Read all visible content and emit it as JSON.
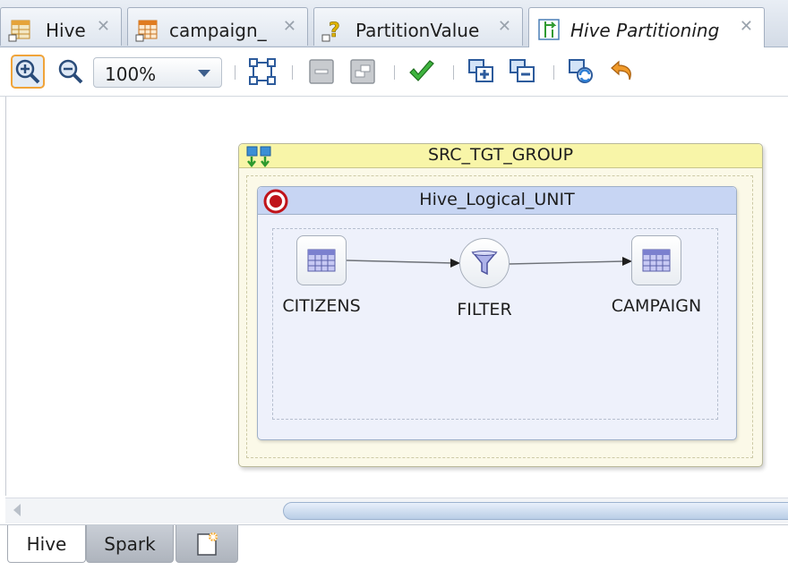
{
  "tabs": [
    {
      "label": "Hive",
      "icon": "hive-table-icon",
      "active": false
    },
    {
      "label": "campaign_",
      "icon": "datastore-table-icon",
      "active": false
    },
    {
      "label": "PartitionValue",
      "icon": "variable-icon",
      "active": false
    },
    {
      "label": "Hive Partitioning",
      "icon": "mapping-icon",
      "active": true
    }
  ],
  "tab_close_glyph": "✕",
  "toolbar": {
    "zoom_in": "zoom-in-icon",
    "zoom_out": "zoom-out-icon",
    "zoom_value": "100%",
    "buttons": [
      "auto-layout-icon",
      "collapse-icon",
      "expand-icon",
      "validate-icon",
      "add-unit-icon",
      "remove-unit-icon",
      "refresh-icon",
      "undo-icon"
    ]
  },
  "diagram": {
    "group_title": "SRC_TGT_GROUP",
    "unit_title": "Hive_Logical_UNIT",
    "nodes": [
      {
        "label": "CITIZENS",
        "icon": "table-grid-icon"
      },
      {
        "label": "FILTER",
        "icon": "filter-funnel-icon"
      },
      {
        "label": "CAMPAIGN",
        "icon": "table-grid-icon"
      }
    ]
  },
  "bottom_tabs": [
    {
      "label": "Hive",
      "active": true
    },
    {
      "label": "Spark",
      "active": false
    },
    {
      "label": "",
      "icon": "add-tab-icon",
      "active": false
    }
  ],
  "colors": {
    "group_header": "#f8f5a8",
    "unit_header": "#c7d5f3",
    "accent_orange": "#f0a43a",
    "validate_green": "#2e9a2e"
  }
}
